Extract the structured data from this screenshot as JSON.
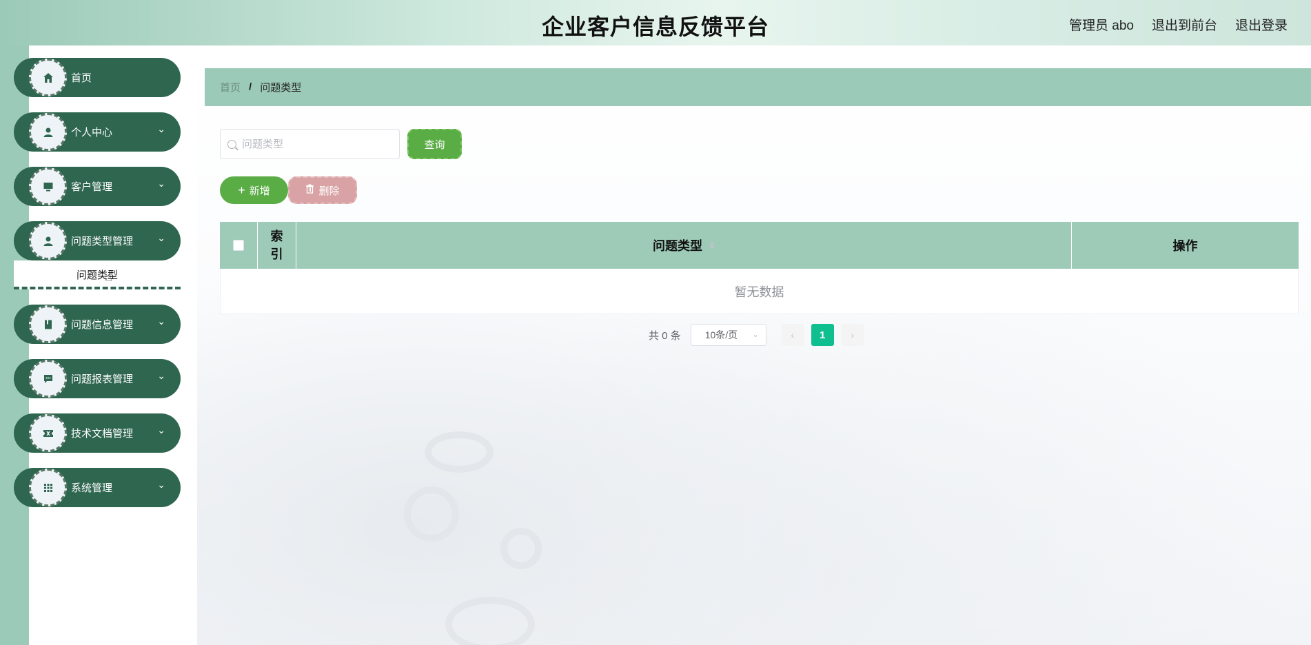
{
  "header": {
    "title": "企业客户信息反馈平台",
    "admin_label": "管理员 abo",
    "exit_front": "退出到前台",
    "logout": "退出登录"
  },
  "sidebar": {
    "items": [
      {
        "label": "首页",
        "icon": "home-icon",
        "has_children": false
      },
      {
        "label": "个人中心",
        "icon": "user-icon",
        "has_children": true
      },
      {
        "label": "客户管理",
        "icon": "monitor-icon",
        "has_children": true
      },
      {
        "label": "问题类型管理",
        "icon": "user-icon",
        "has_children": true
      },
      {
        "label": "问题信息管理",
        "icon": "book-icon",
        "has_children": true
      },
      {
        "label": "问题报表管理",
        "icon": "chat-icon",
        "has_children": true
      },
      {
        "label": "技术文档管理",
        "icon": "ticket-icon",
        "has_children": true
      },
      {
        "label": "系统管理",
        "icon": "grid-icon",
        "has_children": true
      }
    ],
    "submenu_label": "问题类型"
  },
  "breadcrumb": {
    "home": "首页",
    "separator": "/",
    "current": "问题类型"
  },
  "search": {
    "placeholder": "问题类型",
    "value": "",
    "query_label": "查询"
  },
  "actions": {
    "add_label": "新增",
    "delete_label": "删除"
  },
  "table": {
    "columns": {
      "index": "索引",
      "type": "问题类型",
      "operation": "操作"
    },
    "empty_text": "暂无数据"
  },
  "pagination": {
    "total_text": "共 0 条",
    "page_size": "10条/页",
    "current_page": "1"
  },
  "colors": {
    "sidebar_item": "#2e6650",
    "accent_mint": "#9ccab8",
    "button_green": "#5aac44",
    "delete_pink": "#d9a3a5",
    "page_active": "#0fbf8f"
  }
}
